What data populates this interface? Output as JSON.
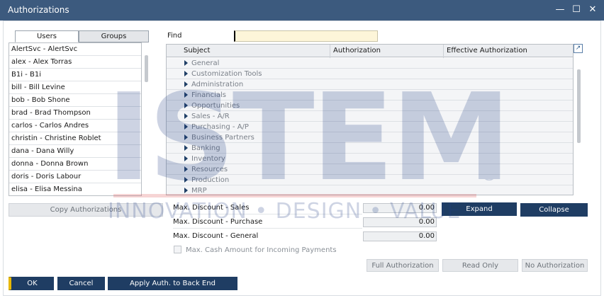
{
  "window": {
    "title": "Authorizations",
    "controls": {
      "minimize": "—",
      "maximize": "☐",
      "close": "✕"
    }
  },
  "tabs": [
    {
      "label": "Users",
      "active": true
    },
    {
      "label": "Groups",
      "active": false
    }
  ],
  "users": [
    "AlertSvc - AlertSvc",
    "alex - Alex Torras",
    "B1i - B1i",
    "bill - Bill Levine",
    "bob - Bob Shone",
    "brad - Brad Thompson",
    "carlos - Carlos Andres",
    "christin - Christine Roblet",
    "dana - Dana Willy",
    "donna - Donna Brown",
    "doris - Doris Labour",
    "elisa - Elisa Messina"
  ],
  "find": {
    "label": "Find",
    "value": ""
  },
  "grid": {
    "columns": [
      "Subject",
      "Authorization",
      "Effective Authorization"
    ],
    "rows": [
      "General",
      "Customization Tools",
      "Administration",
      "Financials",
      "Opportunities",
      "Sales - A/R",
      "Purchasing - A/P",
      "Business Partners",
      "Banking",
      "Inventory",
      "Resources",
      "Production",
      "MRP"
    ]
  },
  "buttons": {
    "copy_authorizations": "Copy Authorizations",
    "expand": "Expand",
    "collapse": "Collapse",
    "full_authorization": "Full Authorization",
    "read_only": "Read Only",
    "no_authorization": "No Authorization",
    "ok": "OK",
    "cancel": "Cancel",
    "apply_auth": "Apply Auth. to Back End"
  },
  "discounts": [
    {
      "label": "Max. Discount - Sales",
      "value": "0.00"
    },
    {
      "label": "Max. Discount - Purchase",
      "value": "0.00"
    },
    {
      "label": "Max. Discount - General",
      "value": "0.00"
    }
  ],
  "max_cash": {
    "label": "Max. Cash Amount for Incoming Payments",
    "checked": false
  },
  "watermark": {
    "logo_text": "ISTEM",
    "registered": "®",
    "tagline": "INNOVATION • DESIGN • VALUE"
  },
  "colors": {
    "titlebar": "#3c5a7e",
    "dark_button": "#1f3d63",
    "ok_accent": "#e8b800",
    "find_bg": "#fdf5d9"
  }
}
